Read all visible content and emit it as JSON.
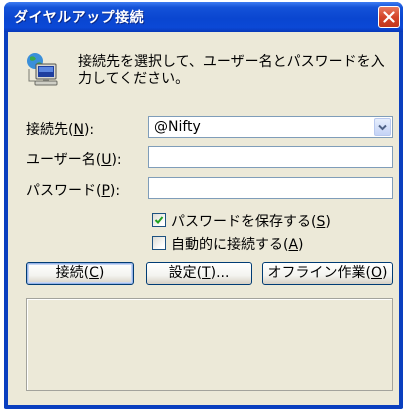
{
  "window": {
    "title": "ダイヤルアップ接続"
  },
  "description": "接続先を選択して、ユーザー名とパスワードを入力してください。",
  "fields": {
    "destination": {
      "label": "接続先(",
      "accel": "N",
      "label_end": "):",
      "value": "@Nifty"
    },
    "username": {
      "label": "ユーザー名(",
      "accel": "U",
      "label_end": "):",
      "value": ""
    },
    "password": {
      "label": "パスワード(",
      "accel": "P",
      "label_end": "):",
      "value": ""
    }
  },
  "checkboxes": {
    "save_password": {
      "label": "パスワードを保存する(",
      "accel": "S",
      "label_end": ")",
      "checked": true
    },
    "auto_connect": {
      "label": "自動的に接続する(",
      "accel": "A",
      "label_end": ")",
      "checked": false
    }
  },
  "buttons": {
    "connect": {
      "label": "接続(",
      "accel": "C",
      "label_end": ")"
    },
    "settings": {
      "label": "設定(",
      "accel": "T",
      "label_end": ")..."
    },
    "offline": {
      "label": "オフライン作業(",
      "accel": "O",
      "label_end": ")"
    }
  },
  "colors": {
    "titlebar": "#0a46d0",
    "window_face": "#ece9d8",
    "close_button": "#d4452a",
    "check_mark": "#21a121"
  },
  "icons": {
    "window_close": "close-icon",
    "dialup": "network-computer-icon",
    "combo_arrow": "chevron-down-icon",
    "checkmark": "check-icon"
  }
}
